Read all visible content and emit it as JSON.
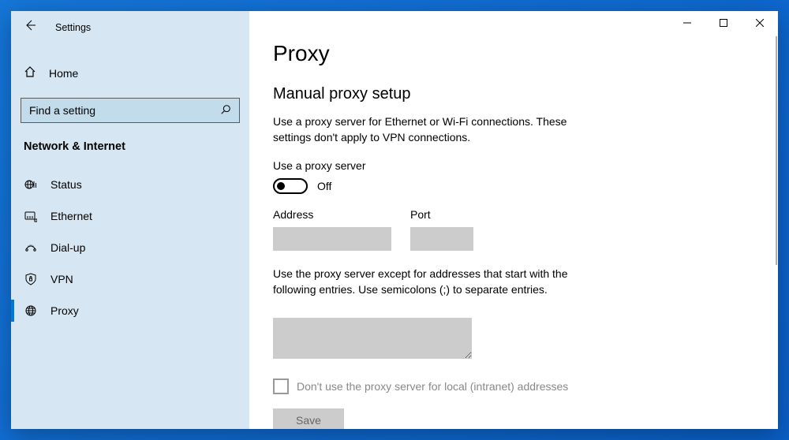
{
  "header": {
    "app_title": "Settings"
  },
  "sidebar": {
    "home_label": "Home",
    "search_placeholder": "Find a setting",
    "category_label": "Network & Internet",
    "items": [
      {
        "label": "Status",
        "icon": "globe-status"
      },
      {
        "label": "Ethernet",
        "icon": "ethernet"
      },
      {
        "label": "Dial-up",
        "icon": "dialup"
      },
      {
        "label": "VPN",
        "icon": "shield"
      },
      {
        "label": "Proxy",
        "icon": "globe"
      }
    ],
    "active_index": 4
  },
  "main": {
    "page_title": "Proxy",
    "manual": {
      "section_title": "Manual proxy setup",
      "description": "Use a proxy server for Ethernet or Wi-Fi connections. These settings don't apply to VPN connections.",
      "use_proxy_label": "Use a proxy server",
      "toggle_state": "Off",
      "address_label": "Address",
      "address_value": "",
      "port_label": "Port",
      "port_value": "",
      "bypass_description": "Use the proxy server except for addresses that start with the following entries. Use semicolons (;) to separate entries.",
      "bypass_value": "",
      "local_checkbox_label": "Don't use the proxy server for local (intranet) addresses",
      "local_checked": false,
      "save_label": "Save"
    }
  }
}
